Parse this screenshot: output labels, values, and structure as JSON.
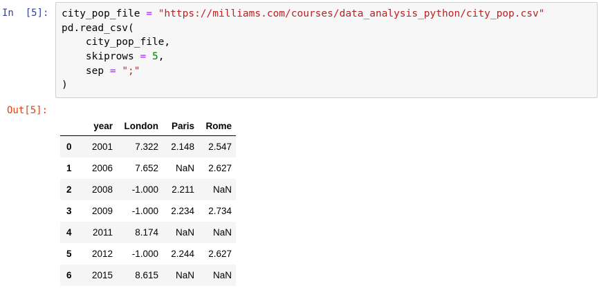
{
  "input_prompt": "In  [5]:",
  "output_prompt": "Out[5]:",
  "code": {
    "line1_var": "city_pop_file",
    "line1_op": "=",
    "line1_str": "\"https://milliams.com/courses/data_analysis_python/city_pop.csv\"",
    "line2": "pd.read_csv(",
    "line3": "    city_pop_file,",
    "line4_name": "    skiprows",
    "line4_op": "=",
    "line4_num": "5",
    "line4_tail": ",",
    "line5_name": "    sep",
    "line5_op": "=",
    "line5_str": "\";\"",
    "line6": ")"
  },
  "table": {
    "columns": [
      "",
      "year",
      "London",
      "Paris",
      "Rome"
    ],
    "rows": [
      {
        "index": "0",
        "year": "2001",
        "London": "7.322",
        "Paris": "2.148",
        "Rome": "2.547"
      },
      {
        "index": "1",
        "year": "2006",
        "London": "7.652",
        "Paris": "NaN",
        "Rome": "2.627"
      },
      {
        "index": "2",
        "year": "2008",
        "London": "-1.000",
        "Paris": "2.211",
        "Rome": "NaN"
      },
      {
        "index": "3",
        "year": "2009",
        "London": "-1.000",
        "Paris": "2.234",
        "Rome": "2.734"
      },
      {
        "index": "4",
        "year": "2011",
        "London": "8.174",
        "Paris": "NaN",
        "Rome": "NaN"
      },
      {
        "index": "5",
        "year": "2012",
        "London": "-1.000",
        "Paris": "2.244",
        "Rome": "2.627"
      },
      {
        "index": "6",
        "year": "2015",
        "London": "8.615",
        "Paris": "NaN",
        "Rome": "NaN"
      }
    ]
  },
  "colors": {
    "input_prompt": "#303f9f",
    "output_prompt": "#d84315",
    "operator": "#aa22ff",
    "string": "#ba2121",
    "number": "#008000"
  }
}
